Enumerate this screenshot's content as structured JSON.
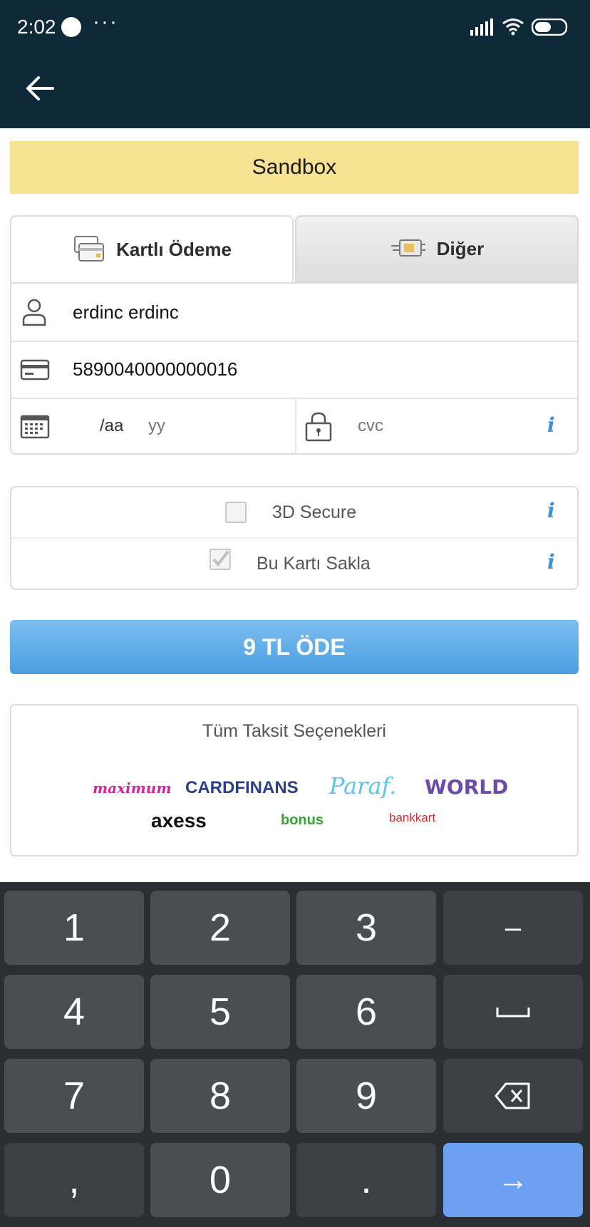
{
  "status_bar": {
    "time": "2:02",
    "more": "···",
    "accent": "#0e2a38"
  },
  "sandbox": {
    "label": "Sandbox",
    "color": "#f8e393"
  },
  "tabs": [
    {
      "label": "Kartlı Ödeme",
      "icon": "card-payment-icon",
      "active": true
    },
    {
      "label": "Diğer",
      "icon": "other-payment-icon",
      "active": false
    }
  ],
  "form": {
    "name": {
      "value": "erdinc erdinc",
      "icon": "person-icon"
    },
    "card_number": {
      "value": "5890040000000016",
      "icon": "credit-card-icon"
    },
    "expiry": {
      "month_placeholder": "/aa",
      "year_placeholder": "yy",
      "icon": "calendar-icon"
    },
    "cvc": {
      "placeholder": "cvc",
      "icon": "lock-icon",
      "info": "i"
    }
  },
  "options": [
    {
      "label": "3D Secure",
      "checked": false,
      "info": "i"
    },
    {
      "label": "Bu Kartı Sakla",
      "checked": true,
      "info": "i"
    }
  ],
  "pay_button": {
    "label": "9 TL ÖDE",
    "color": "#4a9ee0"
  },
  "installments": {
    "title": "Tüm Taksit Seçenekleri",
    "logos": [
      "maximum",
      "CARDFINANS",
      "Paraf.",
      "WORLD",
      "axess",
      "bonus",
      "bankkart"
    ]
  },
  "keyboard": {
    "keys": [
      "1",
      "2",
      "3",
      "–",
      "4",
      "5",
      "6",
      "␣",
      "7",
      "8",
      "9",
      "⌫",
      ",",
      "0",
      ".",
      "→"
    ]
  }
}
